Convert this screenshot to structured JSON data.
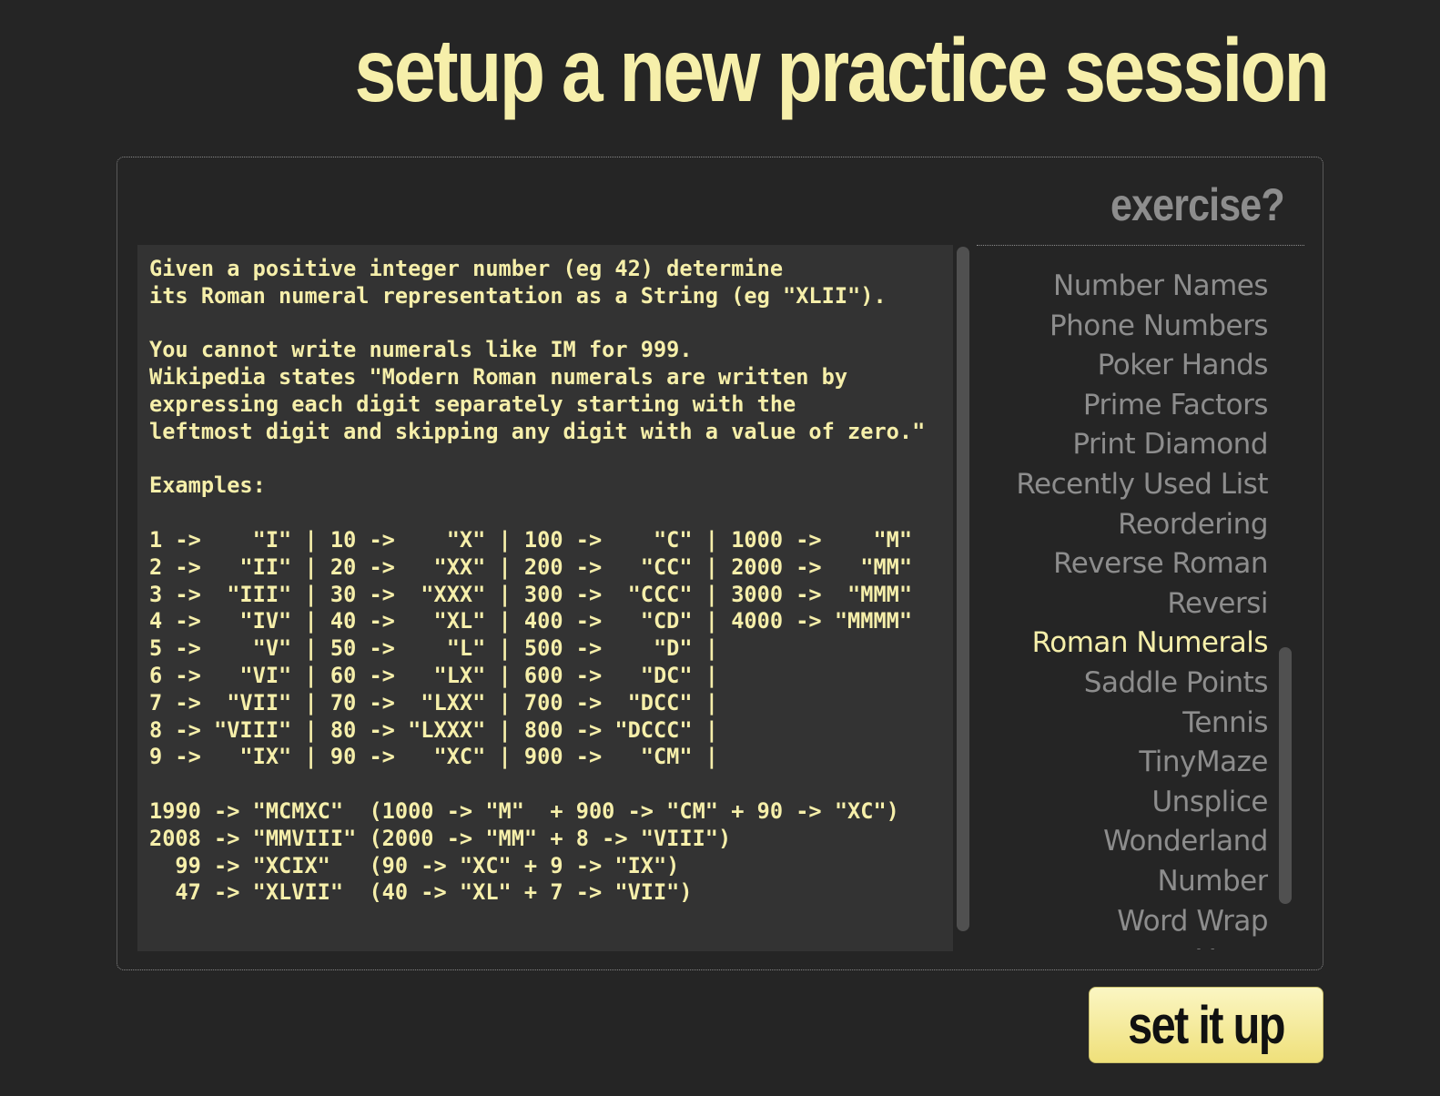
{
  "page": {
    "title": "setup a new practice session"
  },
  "exercise_panel": {
    "heading": "exercise?",
    "instructions": [
      "Given a positive integer number (eg 42) determine",
      "its Roman numeral representation as a String (eg \"XLII\").",
      "",
      "You cannot write numerals like IM for 999.",
      "Wikipedia states \"Modern Roman numerals are written by",
      "expressing each digit separately starting with the",
      "leftmost digit and skipping any digit with a value of zero.\"",
      "",
      "Examples:",
      "",
      "1 ->    \"I\" | 10 ->    \"X\" | 100 ->    \"C\" | 1000 ->    \"M\"",
      "2 ->   \"II\" | 20 ->   \"XX\" | 200 ->   \"CC\" | 2000 ->   \"MM\"",
      "3 ->  \"III\" | 30 ->  \"XXX\" | 300 ->  \"CCC\" | 3000 ->  \"MMM\"",
      "4 ->   \"IV\" | 40 ->   \"XL\" | 400 ->   \"CD\" | 4000 -> \"MMMM\"",
      "5 ->    \"V\" | 50 ->    \"L\" | 500 ->    \"D\" |",
      "6 ->   \"VI\" | 60 ->   \"LX\" | 600 ->   \"DC\" |",
      "7 ->  \"VII\" | 70 ->  \"LXX\" | 700 ->  \"DCC\" |",
      "8 -> \"VIII\" | 80 -> \"LXXX\" | 800 -> \"DCCC\" |",
      "9 ->   \"IX\" | 90 ->   \"XC\" | 900 ->   \"CM\" |",
      "",
      "1990 -> \"MCMXC\"  (1000 -> \"M\"  + 900 -> \"CM\" + 90 -> \"XC\")",
      "2008 -> \"MMVIII\" (2000 -> \"MM\" + 8 -> \"VIII\")",
      "  99 -> \"XCIX\"   (90 -> \"XC\" + 9 -> \"IX\")",
      "  47 -> \"XLVII\"  (40 -> \"XL\" + 7 -> \"VII\")"
    ],
    "exercises": [
      "Number Names",
      "Phone Numbers",
      "Poker Hands",
      "Prime Factors",
      "Print Diamond",
      "Recently Used List",
      "Reordering",
      "Reverse Roman",
      "Reversi",
      "Roman Numerals",
      "Saddle Points",
      "Tennis",
      "TinyMaze",
      "Unsplice",
      "Wonderland",
      "Number",
      "Word Wrap",
      "Yatzy"
    ],
    "selected_exercise": "Roman Numerals"
  },
  "actions": {
    "submit_label": "set it up"
  },
  "colors": {
    "background": "#252525",
    "accent": "#f6efaa",
    "muted": "#8d8d8d",
    "instructions_bg": "#333333",
    "button_bg": "#f3e98f"
  }
}
